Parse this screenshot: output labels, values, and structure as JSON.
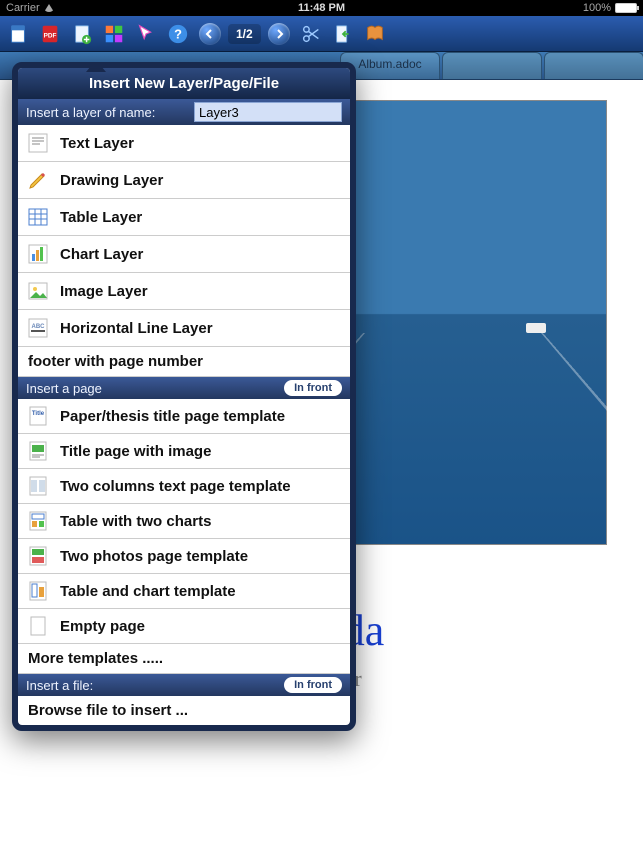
{
  "statusbar": {
    "carrier": "Carrier",
    "time": "11:48 PM",
    "battery": "100%"
  },
  "toolbar": {
    "page_counter": "1/2"
  },
  "tabs": {
    "active": "Album.adoc"
  },
  "document": {
    "title_visible": "uda",
    "subtitle_visible": "or"
  },
  "popover": {
    "title": "Insert New Layer/Page/File",
    "layer_section_label": "Insert a layer of name:",
    "layer_name_value": "Layer3",
    "layers": [
      {
        "label": "Text Layer"
      },
      {
        "label": "Drawing Layer"
      },
      {
        "label": "Table Layer"
      },
      {
        "label": "Chart Layer"
      },
      {
        "label": "Image Layer"
      },
      {
        "label": "Horizontal Line Layer"
      },
      {
        "label": "footer with page number"
      }
    ],
    "page_section_label": "Insert a page",
    "page_pill": "In front",
    "pages": [
      {
        "label": "Paper/thesis title page template"
      },
      {
        "label": "Title page with image"
      },
      {
        "label": "Two columns text page template"
      },
      {
        "label": "Table with two charts"
      },
      {
        "label": "Two photos page template"
      },
      {
        "label": "Table and chart template"
      },
      {
        "label": "Empty page"
      }
    ],
    "more_templates": "More templates .....",
    "file_section_label": "Insert a file:",
    "file_pill": "In front",
    "browse": "Browse file to insert ..."
  }
}
